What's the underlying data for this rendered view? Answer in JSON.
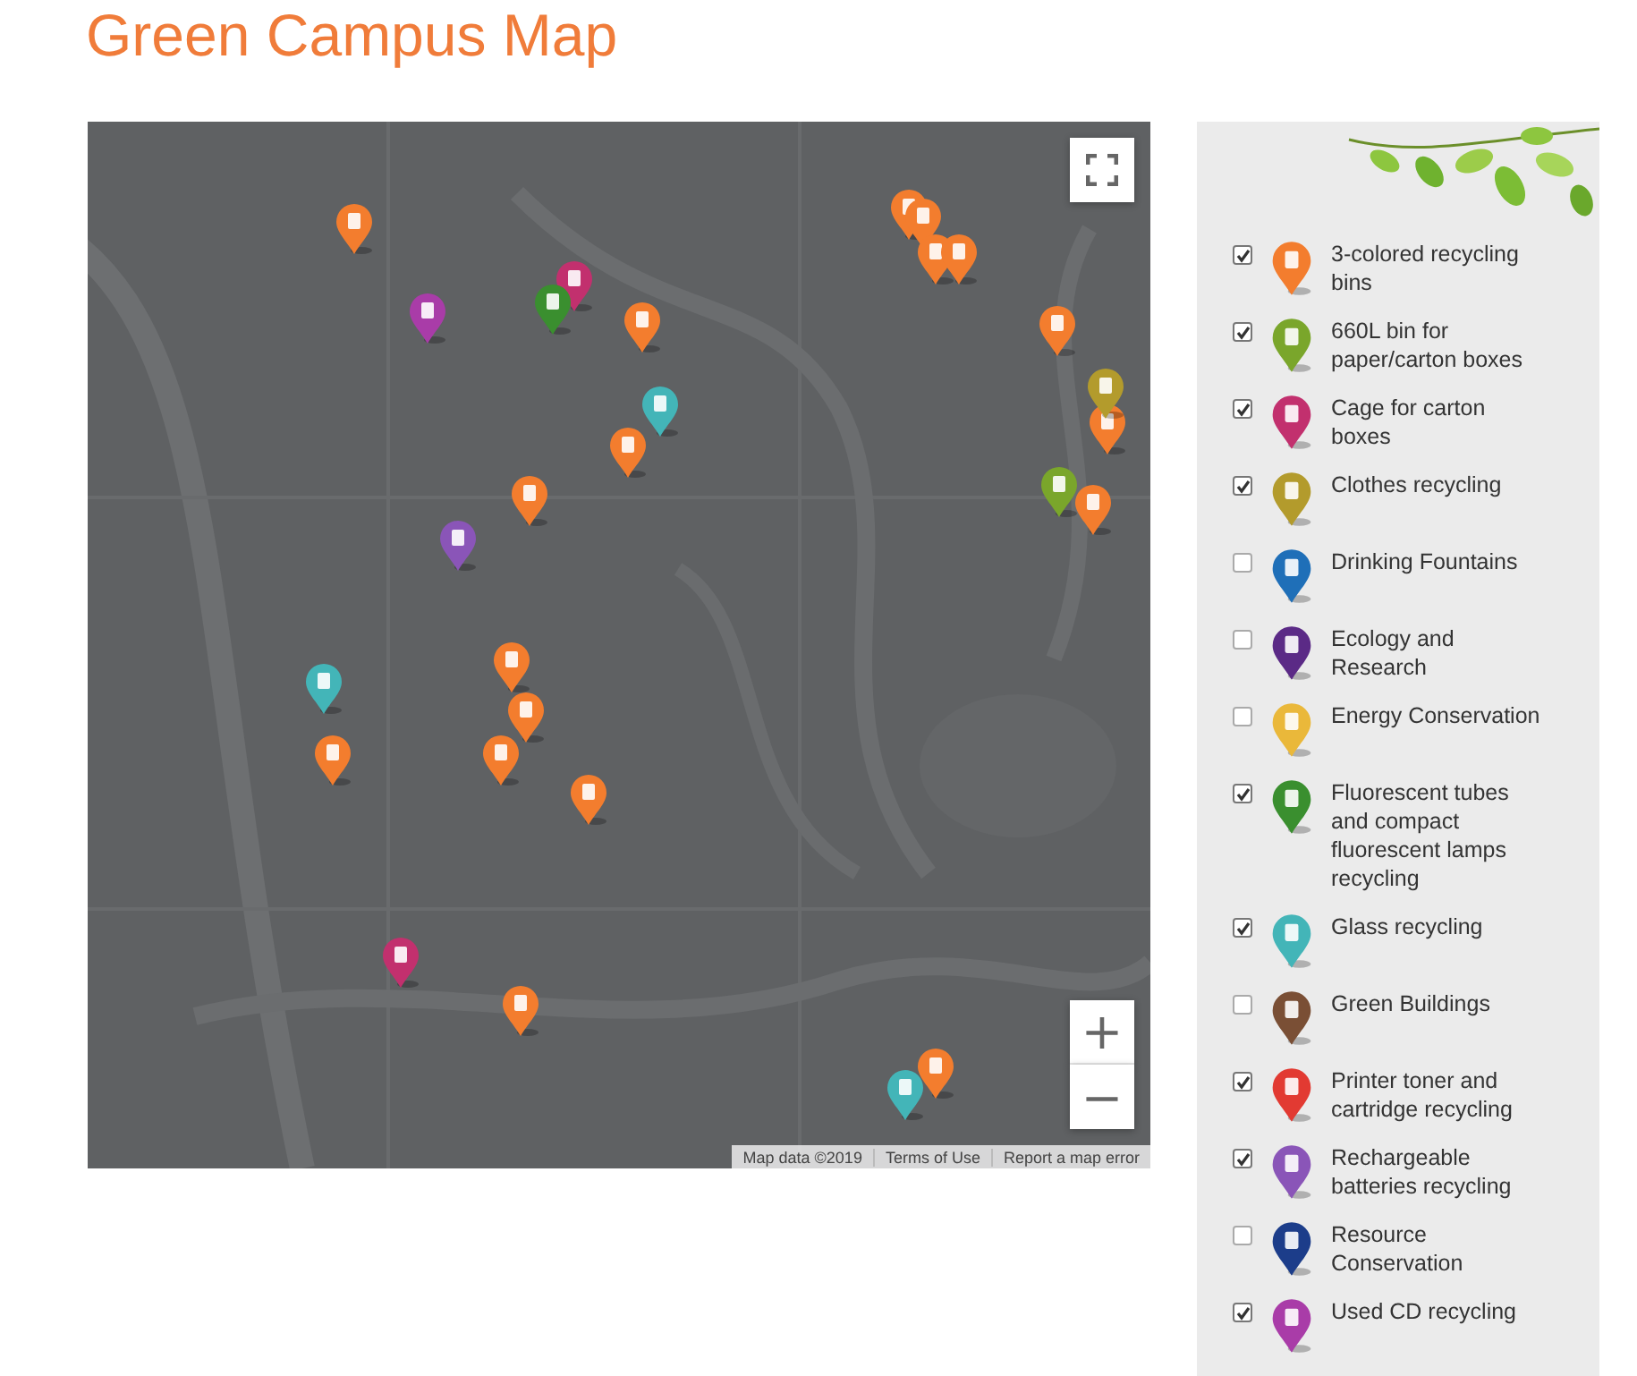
{
  "page": {
    "title": "Green Campus Map"
  },
  "map": {
    "zoom_in": "+",
    "zoom_out": "−",
    "attribution": [
      "Map data ©2019",
      "Terms of Use",
      "Report a map error"
    ]
  },
  "legend": [
    {
      "label": "3-colored recycling bins",
      "checked": true,
      "color": "#f37d2e"
    },
    {
      "label": "660L bin for paper/carton boxes",
      "checked": true,
      "color": "#7aa62b"
    },
    {
      "label": "Cage for carton boxes",
      "checked": true,
      "color": "#c2306e"
    },
    {
      "label": "Clothes recycling",
      "checked": true,
      "color": "#b39b2c"
    },
    {
      "label": "Drinking Fountains",
      "checked": false,
      "color": "#1f6fb8"
    },
    {
      "label": "Ecology and Research",
      "checked": false,
      "color": "#5b2a86"
    },
    {
      "label": "Energy Conservation",
      "checked": false,
      "color": "#eab83a"
    },
    {
      "label": "Fluorescent tubes and compact fluorescent lamps recycling",
      "checked": true,
      "color": "#3a8f2f"
    },
    {
      "label": "Glass recycling",
      "checked": true,
      "color": "#43b5b8"
    },
    {
      "label": "Green Buildings",
      "checked": false,
      "color": "#7a4f35"
    },
    {
      "label": "Printer toner and cartridge recycling",
      "checked": true,
      "color": "#e23a32"
    },
    {
      "label": "Rechargeable batteries recycling",
      "checked": true,
      "color": "#8a55b8"
    },
    {
      "label": "Resource Conservation",
      "checked": false,
      "color": "#1c3d8a"
    },
    {
      "label": "Used CD recycling",
      "checked": true,
      "color": "#a93ca8"
    }
  ]
}
